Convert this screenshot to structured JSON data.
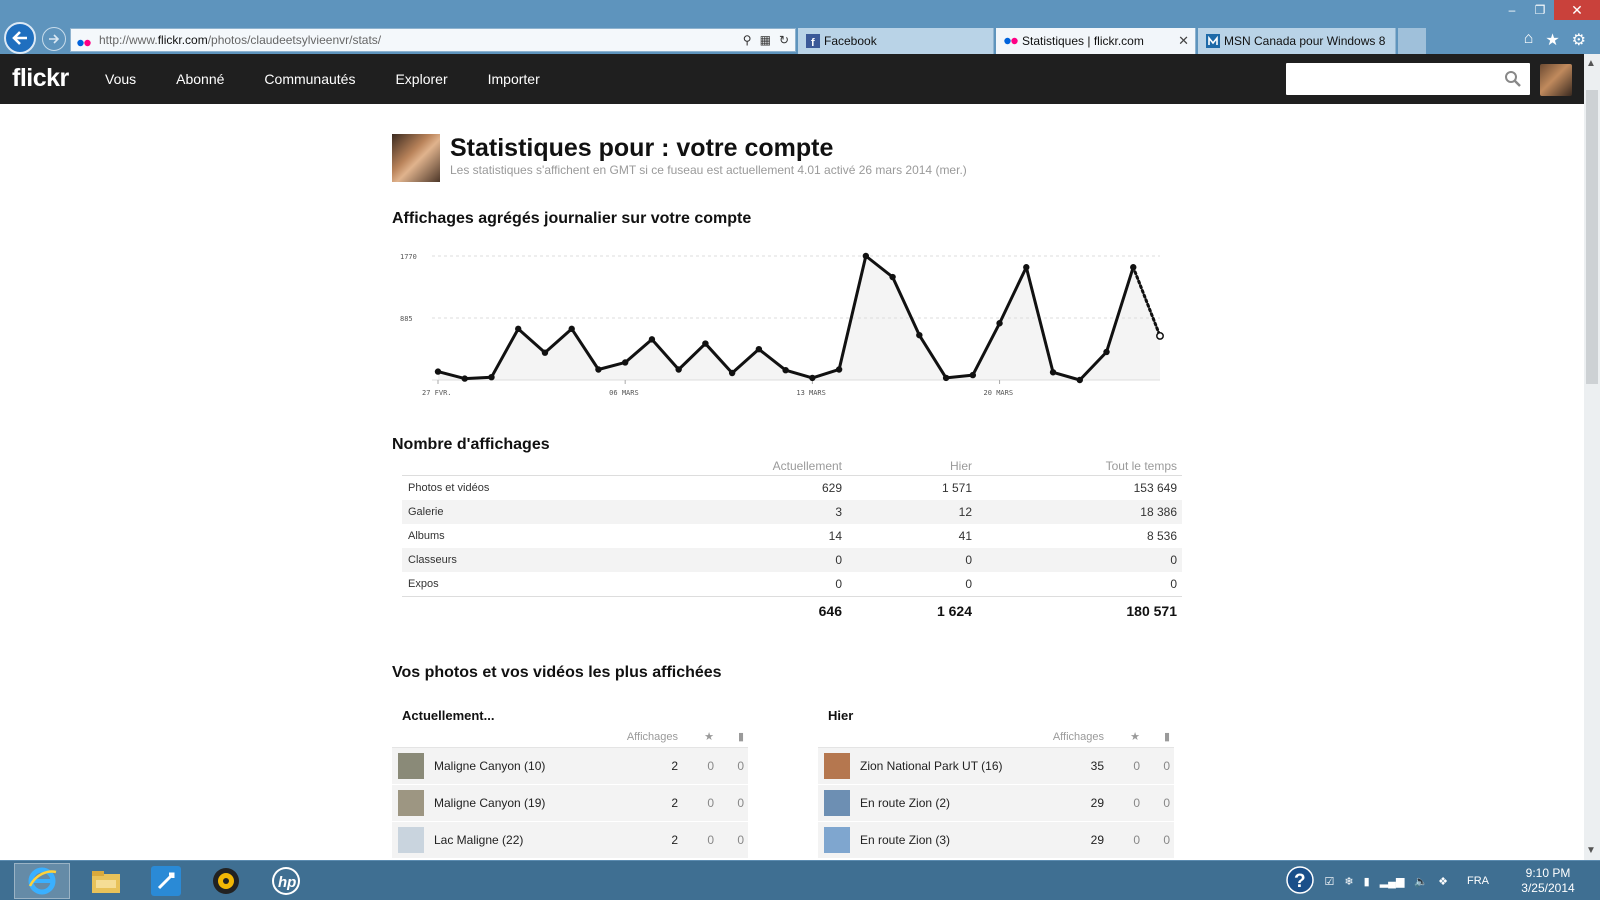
{
  "browser": {
    "url_prefix": "http://www.",
    "url_domain": "flickr.com",
    "url_path": "/photos/claudeetsylvieenvr/stats/",
    "tabs": [
      {
        "label": "Facebook",
        "active": false
      },
      {
        "label": "Statistiques | flickr.com",
        "active": true
      },
      {
        "label": "MSN Canada pour Windows 8",
        "active": false
      }
    ]
  },
  "flickr": {
    "logo": "flickr",
    "nav": [
      "Vous",
      "Abonné",
      "Communautés",
      "Explorer",
      "Importer"
    ]
  },
  "page": {
    "title": "Statistiques pour : votre compte",
    "subtitle": "Les statistiques s'affichent en GMT si ce fuseau est actuellement 4.01 activé 26 mars 2014 (mer.)",
    "chart_heading": "Affichages agrégés journalier sur votre compte",
    "views_heading": "Nombre d'affichages",
    "top_heading": "Vos photos et vos vidéos les plus affichées"
  },
  "chart_data": {
    "type": "line",
    "title": "Affichages agrégés journalier sur votre compte",
    "x_tick_labels": [
      "27 FVR.",
      "06 MARS",
      "13 MARS",
      "20 MARS"
    ],
    "y_tick_labels": [
      "1770",
      "885"
    ],
    "ylim": [
      0,
      1770
    ],
    "grid": true,
    "y": [
      120,
      20,
      40,
      730,
      390,
      730,
      150,
      250,
      580,
      150,
      520,
      100,
      440,
      140,
      30,
      150,
      1770,
      1470,
      640,
      30,
      70,
      810,
      1610,
      110,
      0,
      400,
      1610,
      629
    ],
    "last_segment_dotted": true
  },
  "stats": {
    "headers": [
      "",
      "Actuellement",
      "Hier",
      "Tout le temps"
    ],
    "rows": [
      [
        "Photos et vidéos",
        "629",
        "1 571",
        "153 649"
      ],
      [
        "Galerie",
        "3",
        "12",
        "18 386"
      ],
      [
        "Albums",
        "14",
        "41",
        "8 536"
      ],
      [
        "Classeurs",
        "0",
        "0",
        "0"
      ],
      [
        "Expos",
        "0",
        "0",
        "0"
      ]
    ],
    "totals": [
      "646",
      "1 624",
      "180 571"
    ]
  },
  "top_now": {
    "title": "Actuellement...",
    "col_views": "Affichages",
    "items": [
      {
        "name": "Maligne Canyon (10)",
        "views": "2",
        "favs": "0",
        "comments": "0",
        "color": "#8a8a78"
      },
      {
        "name": "Maligne Canyon (19)",
        "views": "2",
        "favs": "0",
        "comments": "0",
        "color": "#9d9682"
      },
      {
        "name": "Lac Maligne (22)",
        "views": "2",
        "favs": "0",
        "comments": "0",
        "color": "#c9d4de"
      }
    ]
  },
  "top_yesterday": {
    "title": "Hier",
    "col_views": "Affichages",
    "items": [
      {
        "name": "Zion National Park UT (16)",
        "views": "35",
        "favs": "0",
        "comments": "0",
        "color": "#b5774f"
      },
      {
        "name": "En route Zion (2)",
        "views": "29",
        "favs": "0",
        "comments": "0",
        "color": "#6d8fb3"
      },
      {
        "name": "En route Zion (3)",
        "views": "29",
        "favs": "0",
        "comments": "0",
        "color": "#7fa6cf"
      }
    ]
  },
  "taskbar": {
    "tray_lang": "FRA",
    "time": "9:10 PM",
    "date": "3/25/2014"
  }
}
